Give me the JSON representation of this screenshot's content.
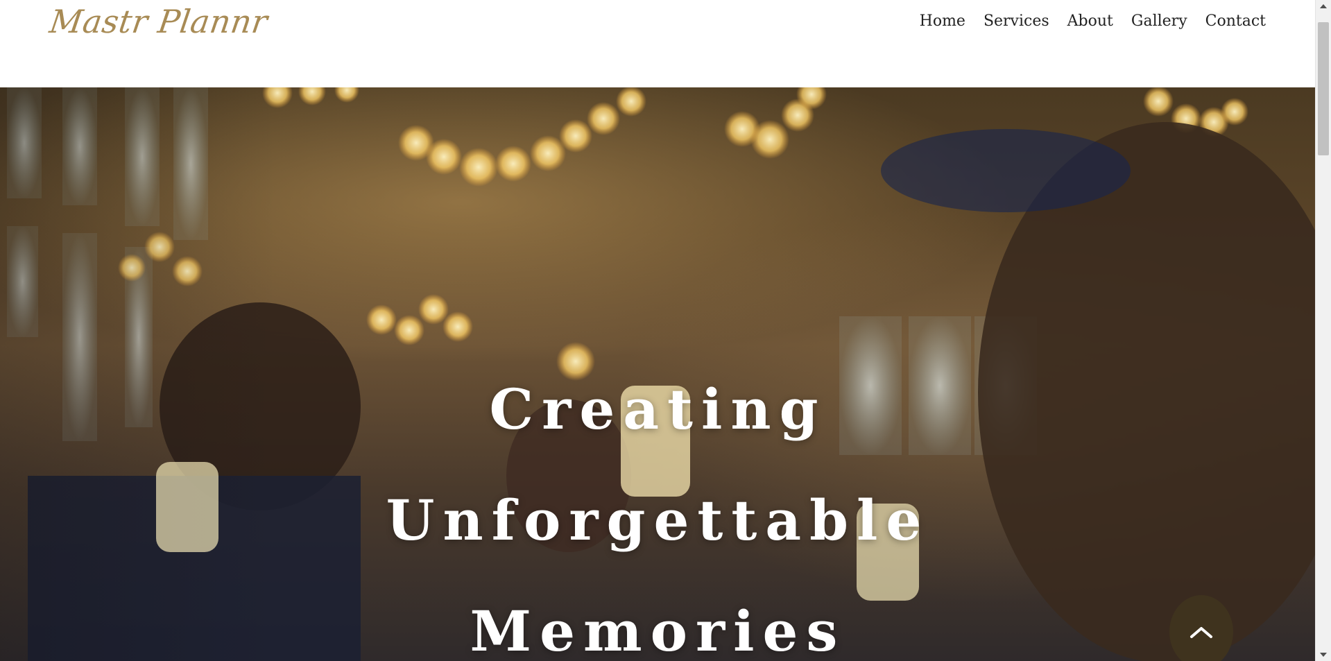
{
  "site": {
    "logo_text": "Mastr Plannr"
  },
  "nav": {
    "items": [
      {
        "label": "Home"
      },
      {
        "label": "Services"
      },
      {
        "label": "About"
      },
      {
        "label": "Gallery"
      },
      {
        "label": "Contact"
      }
    ]
  },
  "hero": {
    "title_lines": [
      "Creating",
      "Unforgettable",
      "Memories"
    ]
  },
  "back_to_top": {
    "icon": "chevron-up-icon"
  },
  "colors": {
    "logo": "#a88b55",
    "back_to_top_bg": "#3f331e",
    "nav_text": "#222222"
  }
}
